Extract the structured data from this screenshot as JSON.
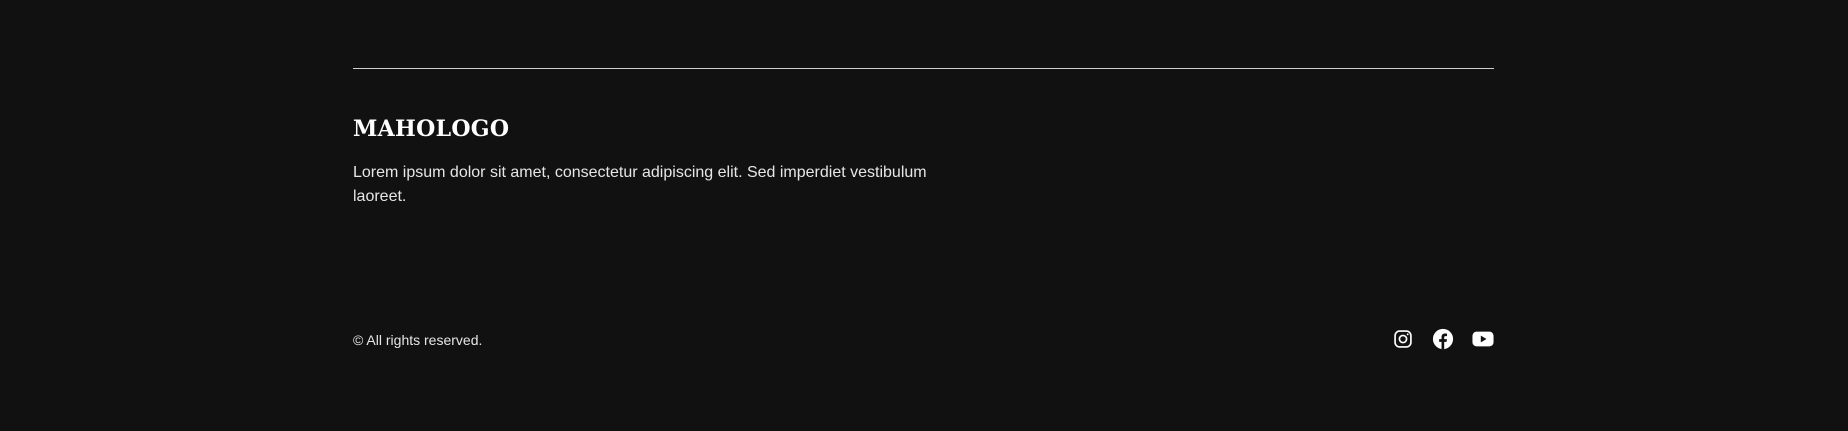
{
  "footer": {
    "logo_text": "MAHOLOGO",
    "description": "Lorem ipsum dolor sit amet, consectetur adipiscing elit. Sed imperdiet vestibulum laoreet.",
    "copyright": "© All rights reserved.",
    "social_icons": [
      "instagram-icon",
      "facebook-icon",
      "youtube-icon"
    ]
  },
  "colors": {
    "background": "#111111",
    "divider": "#cfcfcf",
    "text": "#e6e6e6",
    "icon": "#ffffff"
  }
}
